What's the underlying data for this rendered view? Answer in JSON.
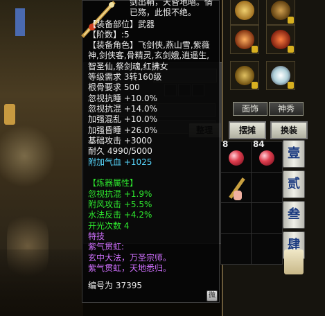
{
  "item": {
    "description": "剑出鞘，天昏地暗。情已殇，此恨不绝。",
    "slot_line": "【装备部位】武器",
    "tier_line": "【阶数】:5",
    "roles_line": "【装备角色】飞剑侠,燕山雪,紫薇神,剑侠客,骨精灵,玄剑娥,逍遥生,智圣仙,祭剑魂,红拂女",
    "level_req": "等级需求 3转160级",
    "bone_req": "根骨要求 500",
    "stats": [
      "忽视抗睡 +10.0%",
      "忽视抗混 +14.0%",
      "加强混乱 +10.0%",
      "加强昏睡 +26.0%",
      "基础攻击 +3000",
      "耐久 4990/5000"
    ],
    "bonus_stat": "附加气血 +1025",
    "refine_header": "【炼器属性】",
    "refine_stats": [
      "忽视抗混 +1.9%",
      "附风攻击 +5.5%",
      "水法反击 +4.2%",
      "开光次数 4"
    ],
    "skill_header": "特技",
    "skill_name": "紫气贯虹:",
    "skill_desc": "玄中大法，万圣宗师。紫气贯虹，天地悉归。",
    "serial": "编号为 37395",
    "close_icon_text": "微"
  },
  "ui": {
    "tab_ornament": "面饰",
    "tab_accessory": "神秀",
    "btn_stall": "摆摊",
    "btn_equip": "换装",
    "btn_organize": "整理",
    "side_tabs": [
      "壹",
      "贰",
      "叁",
      "肆"
    ],
    "inventory_counts": [
      "8",
      "84"
    ]
  }
}
